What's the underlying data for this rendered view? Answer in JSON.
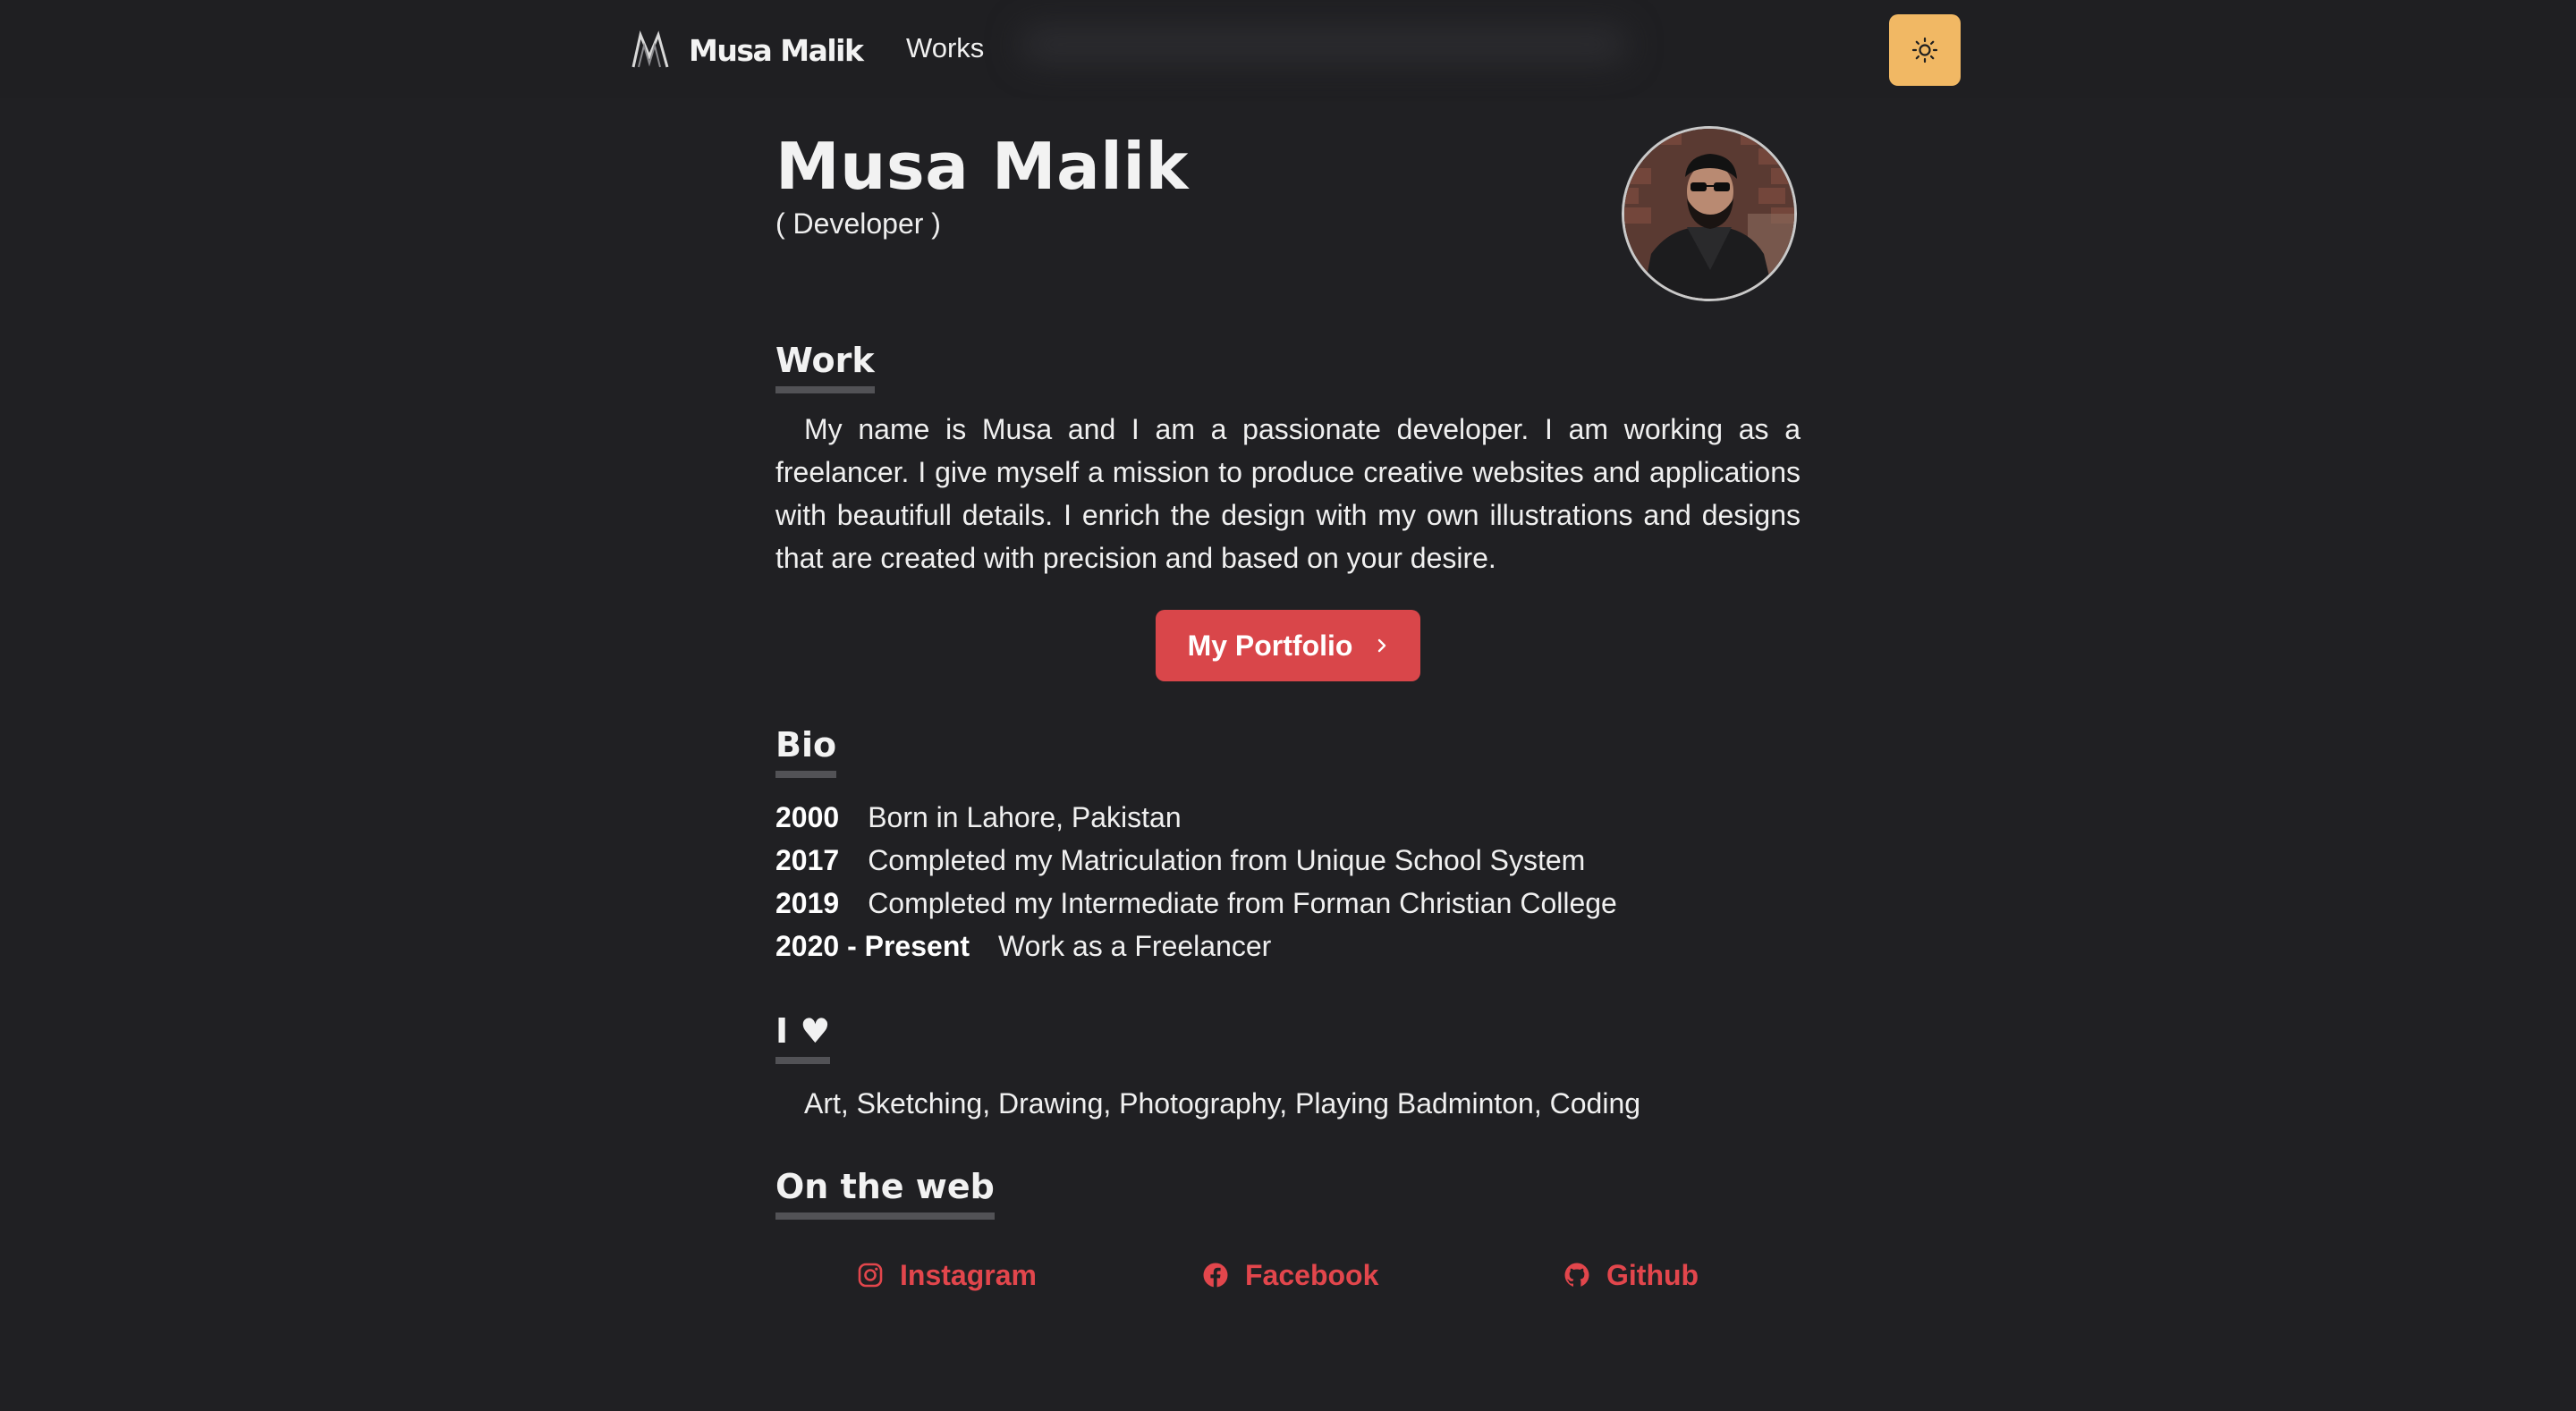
{
  "nav": {
    "brand": "Musa Malik",
    "links": [
      {
        "label": "Works"
      }
    ],
    "theme_icon": "sun-icon"
  },
  "profile": {
    "name": "Musa Malik",
    "role": "( Developer )"
  },
  "work": {
    "heading": "Work",
    "text": "My name is Musa and I am a passionate developer. I am working as a freelancer. I give myself a mission to produce creative websites and applications with beautifull details. I enrich the design with my own illustrations and designs that are created with precision and based on your desire.",
    "button_label": "My Portfolio"
  },
  "bio": {
    "heading": "Bio",
    "items": [
      {
        "year": "2000",
        "text": "Born in Lahore, Pakistan"
      },
      {
        "year": "2017",
        "text": "Completed my Matriculation from Unique School System"
      },
      {
        "year": "2019",
        "text": "Completed my Intermediate from Forman Christian College"
      },
      {
        "year": "2020 - Present",
        "text": "Work as a Freelancer"
      }
    ]
  },
  "love": {
    "heading": "I ♥",
    "text": "Art, Sketching, Drawing, Photography, Playing Badminton, Coding"
  },
  "web": {
    "heading": "On the web",
    "links": [
      {
        "label": "Instagram",
        "icon": "instagram-icon"
      },
      {
        "label": "Facebook",
        "icon": "facebook-icon"
      },
      {
        "label": "Github",
        "icon": "github-icon"
      }
    ]
  },
  "colors": {
    "background": "#202023",
    "accent": "#d9464a",
    "link": "#e2464c",
    "toggle": "#f1b864",
    "underline": "#525256"
  }
}
